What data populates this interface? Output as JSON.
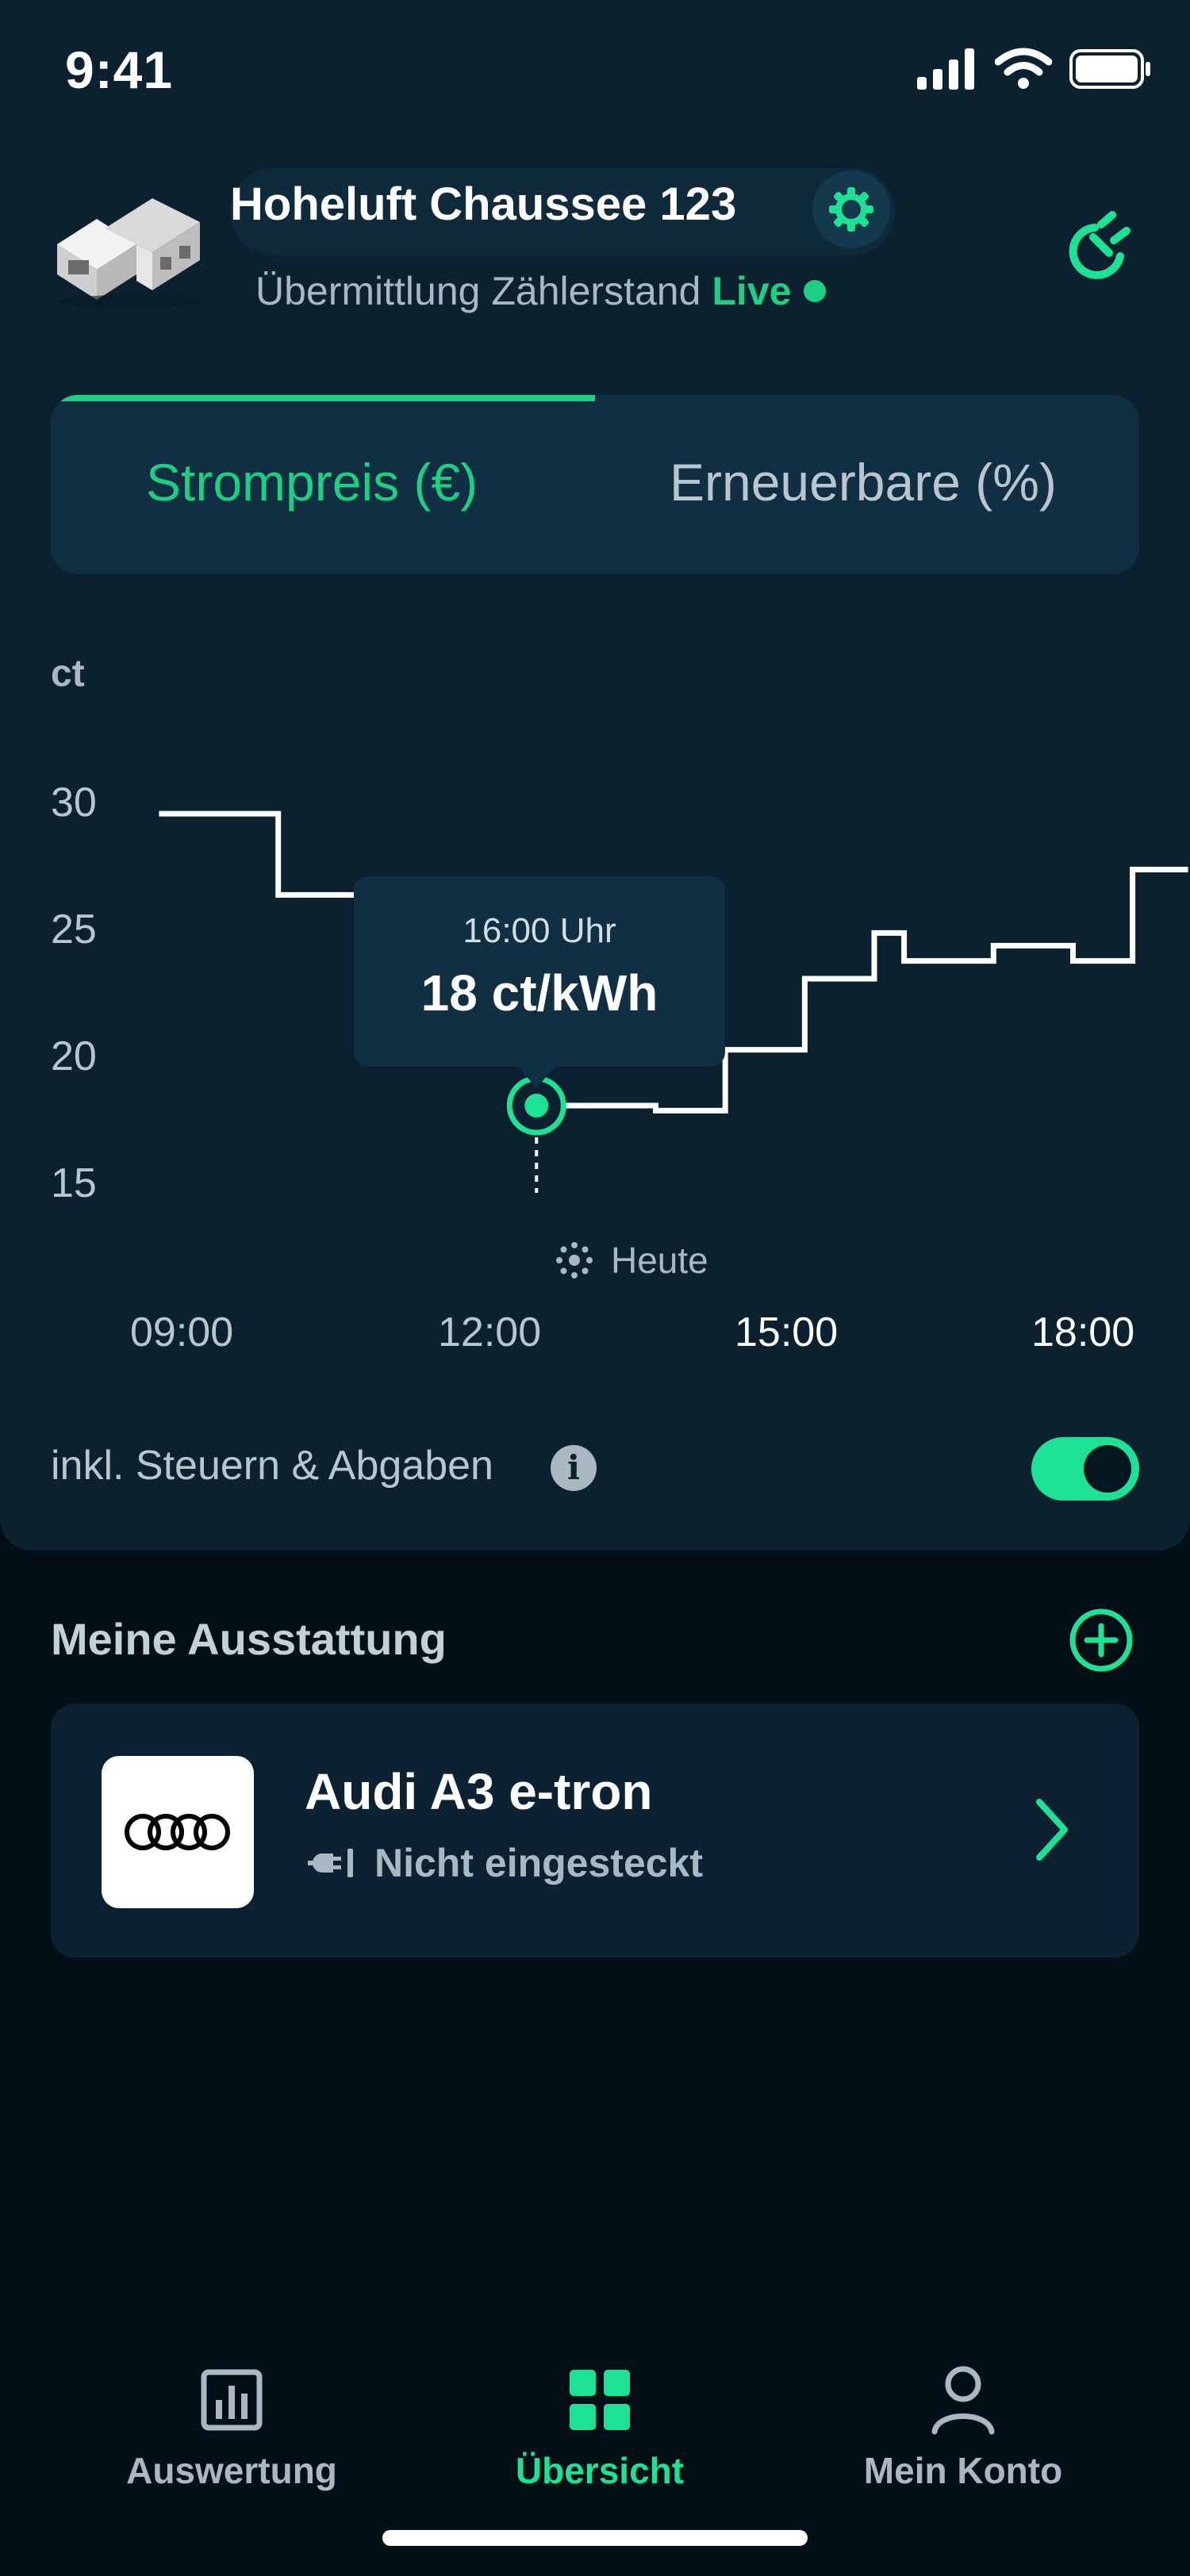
{
  "status_bar": {
    "time": "9:41"
  },
  "header": {
    "address": "Hoheluft Chaussee 123",
    "meter_label": "Übermittlung Zählerstand",
    "meter_status": "Live"
  },
  "tabs": [
    {
      "label": "Strompreis (€)",
      "active": true
    },
    {
      "label": "Erneuerbare (%)",
      "active": false
    }
  ],
  "chart_data": {
    "type": "line",
    "style": "step",
    "ylabel": "ct",
    "ylim": [
      12,
      31
    ],
    "yticks": [
      "30",
      "25",
      "20",
      "15"
    ],
    "xticks": [
      "09:00",
      "12:00",
      "15:00",
      "18:00"
    ],
    "x_hours": [
      8.7,
      9.9,
      10.8,
      11.9,
      12.5,
      13.7,
      14.4,
      15.2,
      15.9,
      16.2,
      17.1,
      17.9,
      18.5
    ],
    "values": [
      29.5,
      26.3,
      23.1,
      20.0,
      18.0,
      17.8,
      20.2,
      23.0,
      24.8,
      23.7,
      24.3,
      23.7,
      27.3
    ],
    "selected": {
      "time": "16:00 Uhr",
      "value_text": "18 ct/kWh",
      "x_hour": 12.5,
      "value": 18.0
    },
    "today_label": "Heute",
    "grid": false,
    "line_color": "#ffffff",
    "marker_color": "#1de296"
  },
  "chart_footer": {
    "taxes_label": "inkl. Steuern & Abgaben",
    "taxes_included": true
  },
  "equipment": {
    "title": "Meine Ausstattung",
    "items": [
      {
        "name": "Audi A3 e-tron",
        "status": "Nicht eingesteckt"
      }
    ]
  },
  "bottom_nav": [
    {
      "label": "Auswertung",
      "icon": "bar-chart-icon",
      "active": false
    },
    {
      "label": "Übersicht",
      "icon": "grid-icon",
      "active": true
    },
    {
      "label": "Mein Konto",
      "icon": "person-icon",
      "active": false
    }
  ],
  "colors": {
    "accent": "#1de296",
    "accent_text": "#1dcf82",
    "panel": "#0b2130",
    "background": "#030f17"
  }
}
